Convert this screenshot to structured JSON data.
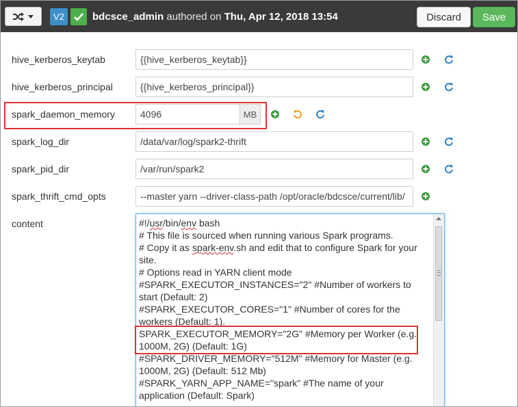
{
  "topbar": {
    "version_badge": "V2",
    "author": "bdcsce_admin",
    "authored_text": "authored on",
    "date": "Thu, Apr 12, 2018 13:54",
    "discard_label": "Discard",
    "save_label": "Save"
  },
  "fields": [
    {
      "label": "hive_kerberos_keytab",
      "value": "{{hive_kerberos_keytab}}"
    },
    {
      "label": "hive_kerberos_principal",
      "value": "{{hive_kerberos_principal}}"
    },
    {
      "label": "spark_daemon_memory",
      "value": "4096",
      "unit": "MB"
    },
    {
      "label": "spark_log_dir",
      "value": "/data/var/log/spark2-thrift"
    },
    {
      "label": "spark_pid_dir",
      "value": "/var/run/spark2"
    },
    {
      "label": "spark_thrift_cmd_opts",
      "value": "--master yarn --driver-class-path /opt/oracle/bdcsce/current/lib/"
    }
  ],
  "content": {
    "label": "content",
    "line1_prefix": "#!/",
    "line1_usr": "usr",
    "line1_mid": "/bin/",
    "line1_env": "env",
    "line1_suffix": " bash",
    "line2": "# This file is sourced when running various Spark programs.",
    "line3_prefix": "# Copy it as ",
    "line3_spark_env": "spark-env",
    "line3_suffix": ".sh and edit that to configure Spark for your site.",
    "line4": "# Options read in YARN client mode",
    "line5": "#SPARK_EXECUTOR_INSTANCES=\"2\" #Number of workers to start (Default: 2)",
    "line6": "#SPARK_EXECUTOR_CORES=\"1\" #Number of cores for the workers (Default: 1).",
    "line7": "SPARK_EXECUTOR_MEMORY=\"2G\" #Memory per Worker (e.g. 1000M, 2G) (Default: 1G)",
    "line8": "#SPARK_DRIVER_MEMORY=\"512M\" #Memory for Master (e.g. 1000M, 2G) (Default: 512 Mb)",
    "line9": "#SPARK_YARN_APP_NAME=\"spark\" #The name of your application (Default: Spark)"
  },
  "colors": {
    "topbar": "#3a3a3a",
    "save": "#5cb85c",
    "add_icon": "#3c9a3c",
    "refresh_icon": "#2a7fc4",
    "undo_icon": "#e6a116",
    "highlight": "#e03030"
  },
  "icons": [
    "shuffle-icon",
    "check-icon",
    "plus-circle-icon",
    "refresh-icon",
    "undo-icon"
  ]
}
